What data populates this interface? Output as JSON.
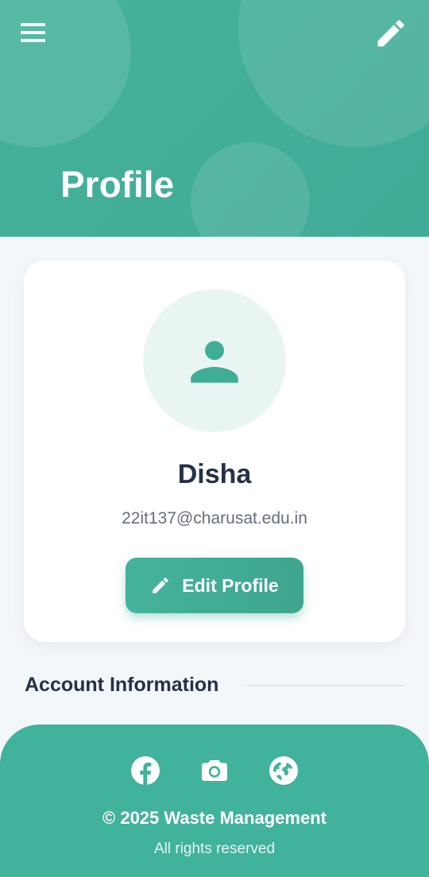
{
  "header": {
    "title": "Profile",
    "menu_icon": "hamburger-menu-icon",
    "edit_icon": "pencil-icon",
    "color": "#42b09a"
  },
  "profile": {
    "avatar_icon": "person-icon",
    "name": "Disha",
    "email": "22it137@charusat.edu.in",
    "edit_button_label": "Edit Profile",
    "edit_button_icon": "pencil-icon"
  },
  "section": {
    "title": "Account Information"
  },
  "footer": {
    "social_icons": [
      "facebook-icon",
      "camera-icon",
      "globe-icon"
    ],
    "copyright": "© 2025 Waste Management",
    "rights": "All rights reserved",
    "color": "#41b29b"
  }
}
